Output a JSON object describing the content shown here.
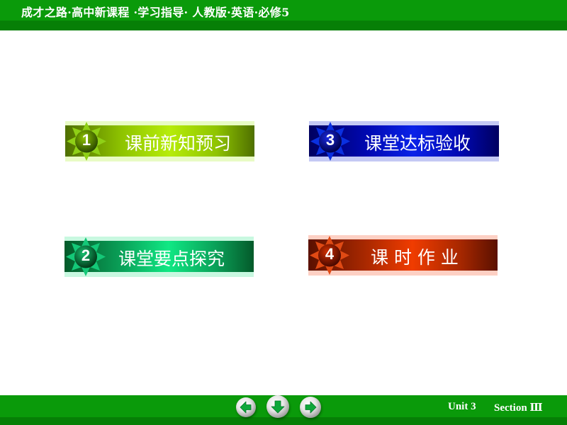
{
  "header": {
    "title": "成才之路·高中新课程 ·学习指导· 人教版·英语·必修5"
  },
  "menu": {
    "items": [
      {
        "number": "1",
        "label": "课前新知预习",
        "icon": "star-badge-icon",
        "color": "#8fc400"
      },
      {
        "number": "2",
        "label": "课堂要点探究",
        "icon": "star-badge-icon",
        "color": "#0aa058"
      },
      {
        "number": "3",
        "label": "课堂达标验收",
        "icon": "star-badge-icon",
        "color": "#0008b0"
      },
      {
        "number": "4",
        "label": "课 时 作 业",
        "icon": "star-badge-icon",
        "color": "#d03000"
      }
    ]
  },
  "footer": {
    "unit": "Unit 3",
    "section": "Section Ⅲ",
    "nav": {
      "prev": "arrow-left-icon",
      "down": "arrow-down-icon",
      "next": "arrow-right-icon"
    }
  },
  "colors": {
    "header_green": "#0a9a0a",
    "header_dark_green": "#067f06"
  }
}
